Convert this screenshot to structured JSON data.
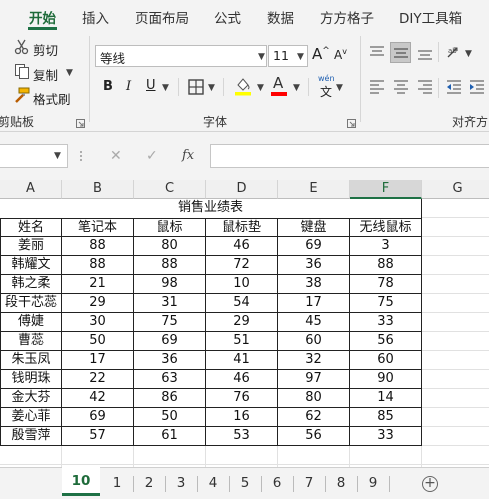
{
  "ribbon_tabs": [
    "开始",
    "插入",
    "页面布局",
    "公式",
    "数据",
    "方方格子",
    "DIY工具箱"
  ],
  "active_tab": "开始",
  "clipboard": {
    "cut": "剪切",
    "copy": "复制",
    "format_painter": "格式刷",
    "group_label": "剪贴板"
  },
  "font": {
    "name": "等线",
    "size": "11",
    "group_label": "字体",
    "bold": "B",
    "italic": "I",
    "underline": "U",
    "font_color_letter": "A",
    "phonetic_top": "wén",
    "phonetic_bottom": "文",
    "grow": "A",
    "shrink": "A"
  },
  "alignment": {
    "group_label": "对齐方"
  },
  "formula_bar": {
    "fx": "fx",
    "cancel": "✕",
    "confirm": "✓"
  },
  "columns": [
    "A",
    "B",
    "C",
    "D",
    "E",
    "F",
    "G"
  ],
  "selected_column": "F",
  "sheet": {
    "title": "销售业绩表",
    "headers": [
      "姓名",
      "笔记本",
      "鼠标",
      "鼠标垫",
      "键盘",
      "无线鼠标"
    ],
    "rows": [
      [
        "姜丽",
        "88",
        "80",
        "46",
        "69",
        "3"
      ],
      [
        "韩耀文",
        "88",
        "88",
        "72",
        "36",
        "88"
      ],
      [
        "韩之柔",
        "21",
        "98",
        "10",
        "38",
        "78"
      ],
      [
        "段干芯蕊",
        "29",
        "31",
        "54",
        "17",
        "75"
      ],
      [
        "傅婕",
        "30",
        "75",
        "29",
        "45",
        "33"
      ],
      [
        "曹蕊",
        "50",
        "69",
        "51",
        "60",
        "56"
      ],
      [
        "朱玉凤",
        "17",
        "36",
        "41",
        "32",
        "60"
      ],
      [
        "钱明珠",
        "22",
        "63",
        "46",
        "97",
        "90"
      ],
      [
        "金大芬",
        "42",
        "86",
        "76",
        "80",
        "14"
      ],
      [
        "姜心菲",
        "69",
        "50",
        "16",
        "62",
        "85"
      ],
      [
        "殷雪萍",
        "57",
        "61",
        "53",
        "56",
        "33"
      ]
    ]
  },
  "sheet_tabs": [
    "10",
    "1",
    "2",
    "3",
    "4",
    "5",
    "6",
    "7",
    "8",
    "9"
  ],
  "active_sheet": "10",
  "colors": {
    "accent": "#1e7145",
    "highlight": "#ffff00",
    "font_color": "#ff0000",
    "table_border": "#222222"
  }
}
